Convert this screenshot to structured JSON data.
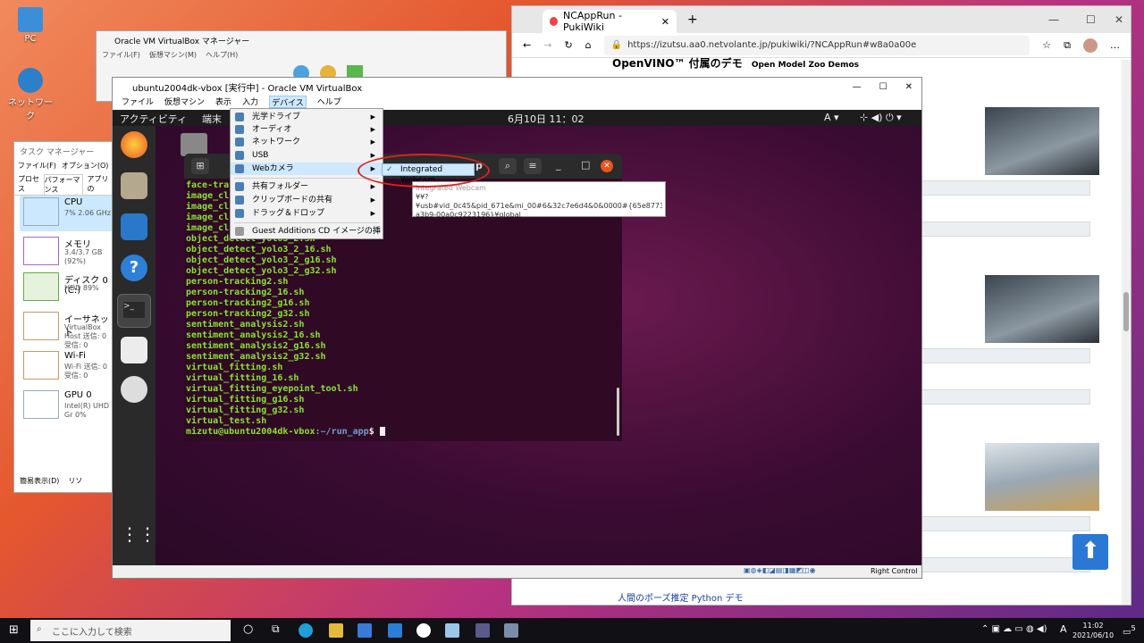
{
  "desktop": {
    "icons": [
      "PC",
      "ネットワーク"
    ]
  },
  "browser": {
    "tab_title": "NCAppRun - PukiWiki",
    "url": "https://izutsu.aa0.netvolante.jp/pukiwiki/?NCAppRun#w8a0a00e",
    "heading": "OpenVINO™ 付属のデモ",
    "heading_sub": "Open Model Zoo Demos",
    "footer_link": "人間のポーズ推定 Python デモ"
  },
  "vbox_manager": {
    "title": "Oracle VM VirtualBox マネージャー",
    "menu": [
      "ファイル(F)",
      "仮想マシン(M)",
      "ヘルプ(H)"
    ]
  },
  "task_manager": {
    "title": "タスク マネージャー",
    "menu": [
      "ファイル(F)",
      "オプション(O)"
    ],
    "tabs": [
      "プロセス",
      "パフォーマンス",
      "アプリの"
    ],
    "items": [
      {
        "name": "CPU",
        "sub": "7% 2.06 GHz"
      },
      {
        "name": "メモリ",
        "sub": "3.4/3.7 GB (92%)"
      },
      {
        "name": "ディスク 0 (C:)",
        "sub": "HDD 89%"
      },
      {
        "name": "イーサネット",
        "sub": "VirtualBox Host 送信: 0 受信: 0"
      },
      {
        "name": "Wi-Fi",
        "sub": "Wi-Fi 送信: 0 受信: 0"
      },
      {
        "name": "GPU 0",
        "sub": "Intel(R) UHD Gr 0%"
      }
    ],
    "footer": "簡易表示(D)",
    "footer2": "リソ"
  },
  "vm": {
    "title": "ubuntu2004dk-vbox [実行中] - Oracle VM VirtualBox",
    "menu": [
      "ファイル",
      "仮想マシン",
      "表示",
      "入力",
      "デバイス",
      "ヘルプ"
    ],
    "activities": "アクティビティ",
    "app_label": "端末",
    "datetime": "6月10日  11：02",
    "input": "A",
    "host_key": "Right Control"
  },
  "devices_menu": {
    "items": [
      "光学ドライブ",
      "オーディオ",
      "ネットワーク",
      "USB",
      "Webカメラ",
      "共有フォルダー",
      "クリップボードの共有",
      "ドラッグ＆ドロップ",
      "Guest Additions CD イメージの挿入..."
    ],
    "submenu_item": "Integrated Webcam",
    "tooltip_lines": [
      "Integrated Webcam",
      "¥¥?",
      "¥usb#vid_0c45&pid_671e&mi_00#6&32c7e6d4&0&0000#{65e8773d-8f56-11d0-",
      "a3b9-00a0c9223196}¥global"
    ]
  },
  "terminal": {
    "title": "p",
    "lines": [
      "face-tra",
      "image_cl",
      "image_cl",
      "image_cl",
      "image_cl",
      "object_detect_yolo3_2.sh",
      "object_detect_yolo3_2_16.sh",
      "object_detect_yolo3_2_g16.sh",
      "object_detect_yolo3_2_g32.sh",
      "person-tracking2.sh",
      "person-tracking2_16.sh",
      "person-tracking2_g16.sh",
      "person-tracking2_g32.sh",
      "sentiment_analysis2.sh",
      "sentiment_analysis2_16.sh",
      "sentiment_analysis2_g16.sh",
      "sentiment_analysis2_g32.sh",
      "virtual_fitting.sh",
      "virtual_fitting_16.sh",
      "virtual_fitting_eyepoint_tool.sh",
      "virtual_fitting_g16.sh",
      "virtual_fitting_g32.sh",
      "virtual_test.sh"
    ],
    "prompt_user": "mizutu@ubuntu2004dk-vbox",
    "prompt_path": ":~/run_app",
    "prompt_end": "$"
  },
  "taskbar": {
    "search_placeholder": "ここに入力して検索",
    "time": "11:02",
    "date": "2021/06/10",
    "ime": "A",
    "notif_count": "5"
  }
}
